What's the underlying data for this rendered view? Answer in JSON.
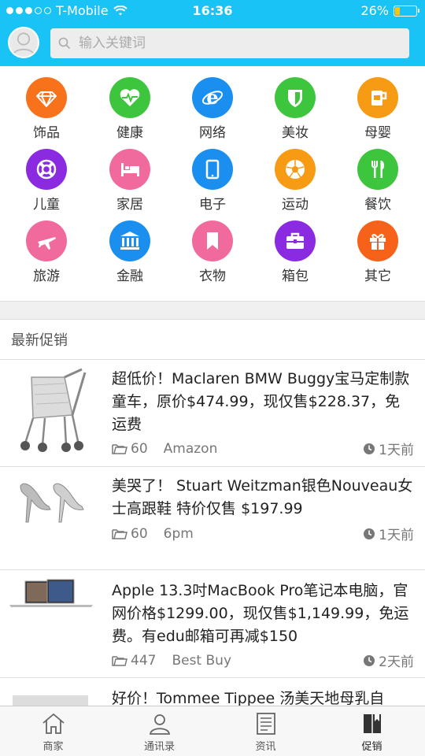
{
  "status": {
    "carrier": "T-Mobile",
    "time": "16:36",
    "battery": "26%"
  },
  "search": {
    "placeholder": "输入关键词"
  },
  "categories": [
    {
      "label": "饰品",
      "color": "#f7721a",
      "icon": "diamond-icon"
    },
    {
      "label": "健康",
      "color": "#3dc63d",
      "icon": "heartbeat-icon"
    },
    {
      "label": "网络",
      "color": "#1a8ff0",
      "icon": "ie-icon"
    },
    {
      "label": "美妆",
      "color": "#3dc63d",
      "icon": "shield-icon"
    },
    {
      "label": "母婴",
      "color": "#f79a14",
      "icon": "cup-icon"
    },
    {
      "label": "儿童",
      "color": "#8a2be2",
      "icon": "lifebuoy-icon"
    },
    {
      "label": "家居",
      "color": "#f06a9e",
      "icon": "bed-icon"
    },
    {
      "label": "电子",
      "color": "#1a8ff0",
      "icon": "tablet-icon"
    },
    {
      "label": "运动",
      "color": "#f79a14",
      "icon": "soccer-icon"
    },
    {
      "label": "餐饮",
      "color": "#3dc63d",
      "icon": "cutlery-icon"
    },
    {
      "label": "旅游",
      "color": "#f06a9e",
      "icon": "plane-icon"
    },
    {
      "label": "金融",
      "color": "#1a8ff0",
      "icon": "bank-icon"
    },
    {
      "label": "衣物",
      "color": "#f06a9e",
      "icon": "bookmark-icon"
    },
    {
      "label": "箱包",
      "color": "#8a2be2",
      "icon": "briefcase-icon"
    },
    {
      "label": "其它",
      "color": "#f7621a",
      "icon": "gift-icon"
    }
  ],
  "section_title": "最新促销",
  "deals": [
    {
      "title": "超低价！Maclaren BMW Buggy宝马定制款童车，原价$474.99，现仅售$228.37，免运费",
      "count": "60",
      "store": "Amazon",
      "time": "1天前"
    },
    {
      "title": "美哭了！ Stuart Weitzman银色Nouveau女士高跟鞋 特价仅售 $197.99",
      "count": "60",
      "store": "6pm",
      "time": "1天前"
    },
    {
      "title": "Apple 13.3吋MacBook Pro笔记本电脑，官网价格$1299.00，现仅售$1,149.99，免运费。有edu邮箱可再减$150",
      "count": "447",
      "store": "Best Buy",
      "time": "2天前"
    },
    {
      "title": "好价！Tommee Tippee 汤美天地母乳自"
    }
  ],
  "tabs": [
    {
      "label": "商家",
      "icon": "home-icon"
    },
    {
      "label": "通讯录",
      "icon": "contacts-icon"
    },
    {
      "label": "资讯",
      "icon": "news-icon"
    },
    {
      "label": "促销",
      "icon": "book-icon",
      "active": true
    }
  ]
}
